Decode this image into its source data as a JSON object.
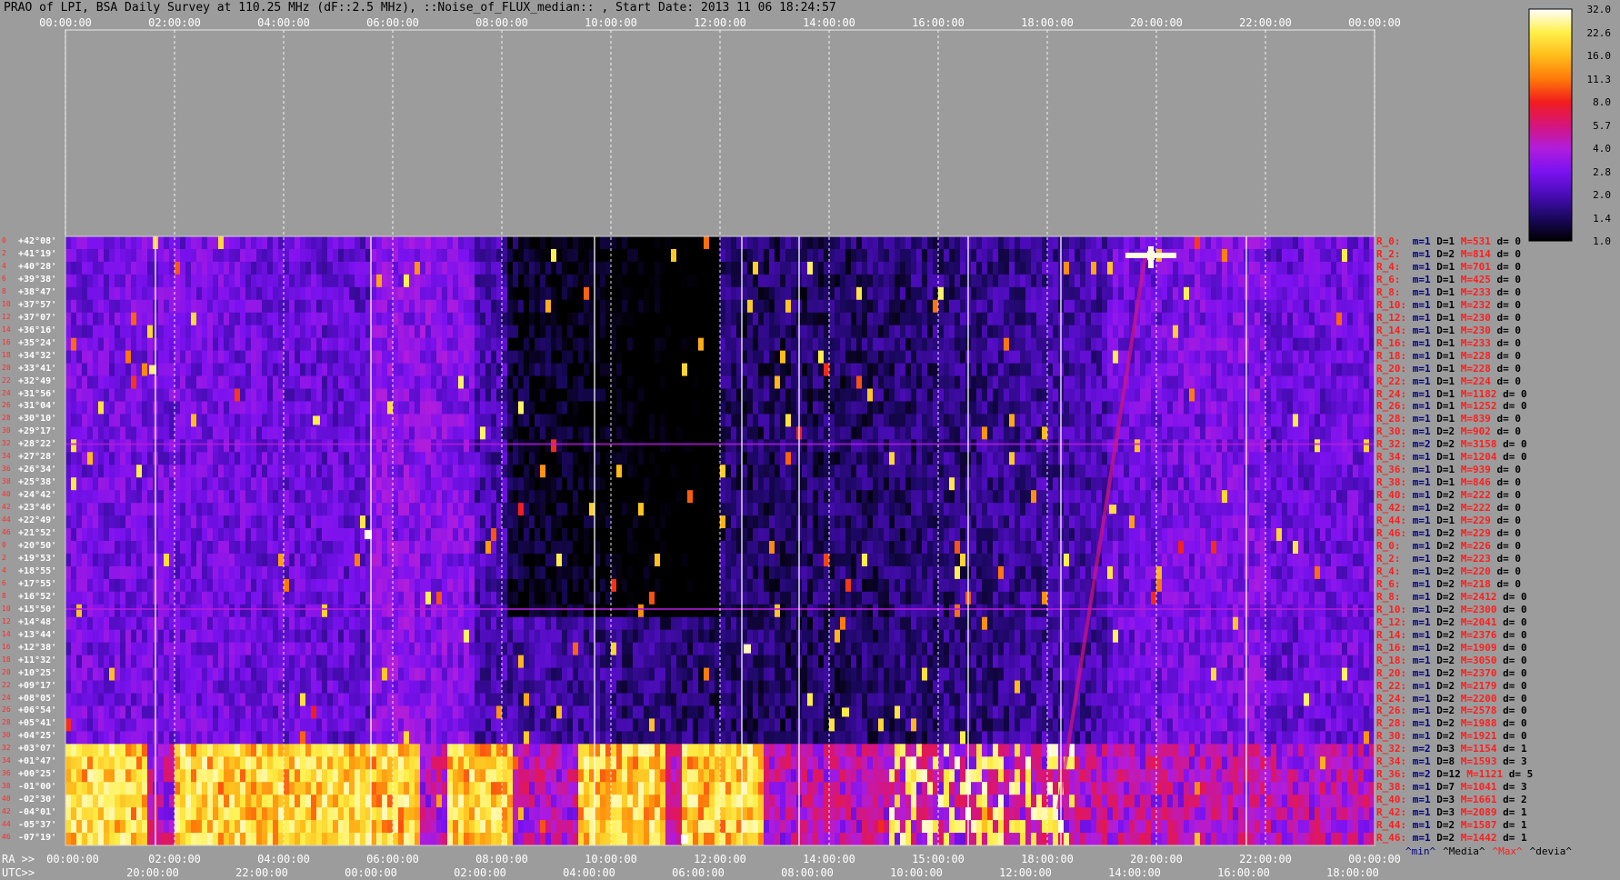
{
  "title": "PRAO of LPI, BSA Daily Survey at 110.25 MHz (dF::2.5 MHz), ::Noise_of_FLUX_median:: , Start Date: 2013 11 06 18:24:57",
  "axes": {
    "top_ticks": [
      "00:00:00",
      "02:00:00",
      "04:00:00",
      "06:00:00",
      "08:00:00",
      "10:00:00",
      "12:00:00",
      "14:00:00",
      "16:00:00",
      "18:00:00",
      "20:00:00",
      "22:00:00",
      "00:00:00"
    ],
    "ra_label": "RA >>",
    "ra_ticks": [
      "00:00:00",
      "02:00:00",
      "04:00:00",
      "06:00:00",
      "08:00:00",
      "10:00:00",
      "12:00:00",
      "14:00:00",
      "15:00:00",
      "18:00:00",
      "20:00:00",
      "22:00:00",
      "00:00:00"
    ],
    "utc_label": "UTC>>",
    "utc_ticks": [
      "20:00:00",
      "22:00:00",
      "00:00:00",
      "02:00:00",
      "04:00:00",
      "06:00:00",
      "08:00:00",
      "10:00:00",
      "12:00:00",
      "14:00:00",
      "16:00:00",
      "18:00:00"
    ]
  },
  "colorbar": {
    "labels": [
      "32.0",
      "22.6",
      "16.0",
      "11.3",
      "8.0",
      "5.7",
      "4.0",
      "2.8",
      "2.0",
      "1.4",
      "1.0"
    ],
    "colors": [
      "#ffffff",
      "#fff04a",
      "#ffbd1a",
      "#ff7a0a",
      "#f21d1d",
      "#d6157a",
      "#b11ddc",
      "#7b12f0",
      "#4a0cb8",
      "#1a0860",
      "#000000"
    ]
  },
  "legend_keys": [
    {
      "text": "^min^",
      "color": "#000080"
    },
    {
      "text": "^Media^",
      "color": "#000000"
    },
    {
      "text": "^Max^",
      "color": "#ff1e1e"
    },
    {
      "text": "^devia^",
      "color": "#000000"
    }
  ],
  "chart_data": {
    "type": "heatmap",
    "title": "PRAO of LPI, BSA Daily Survey at 110.25 MHz (dF::2.5 MHz), ::Noise_of_FLUX_median:: , Start Date: 2013 11 06 18:24:57",
    "x_unit": "RA (h)",
    "x_range": [
      0,
      24
    ],
    "y_unit": "declination (beam index)",
    "value_scale": "log",
    "value_range": [
      1.0,
      32.0
    ],
    "declinations": [
      {
        "idx": "0",
        "dec": "+42°08'",
        "stat": "R_0: ",
        "min": "m=1",
        "d": "D=1",
        "max": "M=531",
        "dev": "d= 0"
      },
      {
        "idx": "2",
        "dec": "+41°19'",
        "stat": "R_2: ",
        "min": "m=1",
        "d": "D=2",
        "max": "M=814",
        "dev": "d= 0"
      },
      {
        "idx": "4",
        "dec": "+40°28'",
        "stat": "R_4: ",
        "min": "m=1",
        "d": "D=1",
        "max": "M=701",
        "dev": "d= 0"
      },
      {
        "idx": "6",
        "dec": "+39°38'",
        "stat": "R_6: ",
        "min": "m=1",
        "d": "D=1",
        "max": "M=425",
        "dev": "d= 0"
      },
      {
        "idx": "8",
        "dec": "+38°47'",
        "stat": "R_8: ",
        "min": "m=1",
        "d": "D=1",
        "max": "M=233",
        "dev": "d= 0"
      },
      {
        "idx": "10",
        "dec": "+37°57'",
        "stat": "R_10:",
        "min": "m=1",
        "d": "D=1",
        "max": "M=232",
        "dev": "d= 0"
      },
      {
        "idx": "12",
        "dec": "+37°07'",
        "stat": "R_12:",
        "min": "m=1",
        "d": "D=1",
        "max": "M=230",
        "dev": "d= 0"
      },
      {
        "idx": "14",
        "dec": "+36°16'",
        "stat": "R_14:",
        "min": "m=1",
        "d": "D=1",
        "max": "M=230",
        "dev": "d= 0"
      },
      {
        "idx": "16",
        "dec": "+35°24'",
        "stat": "R_16:",
        "min": "m=1",
        "d": "D=1",
        "max": "M=233",
        "dev": "d= 0"
      },
      {
        "idx": "18",
        "dec": "+34°32'",
        "stat": "R_18:",
        "min": "m=1",
        "d": "D=1",
        "max": "M=228",
        "dev": "d= 0"
      },
      {
        "idx": "20",
        "dec": "+33°41'",
        "stat": "R_20:",
        "min": "m=1",
        "d": "D=1",
        "max": "M=228",
        "dev": "d= 0"
      },
      {
        "idx": "22",
        "dec": "+32°49'",
        "stat": "R_22:",
        "min": "m=1",
        "d": "D=1",
        "max": "M=224",
        "dev": "d= 0"
      },
      {
        "idx": "24",
        "dec": "+31°56'",
        "stat": "R_24:",
        "min": "m=1",
        "d": "D=1",
        "max": "M=1182",
        "dev": "d= 0"
      },
      {
        "idx": "26",
        "dec": "+31°04'",
        "stat": "R_26:",
        "min": "m=1",
        "d": "D=1",
        "max": "M=1252",
        "dev": "d= 0"
      },
      {
        "idx": "28",
        "dec": "+30°10'",
        "stat": "R_28:",
        "min": "m=1",
        "d": "D=1",
        "max": "M=839",
        "dev": "d= 0"
      },
      {
        "idx": "30",
        "dec": "+29°17'",
        "stat": "R_30:",
        "min": "m=1",
        "d": "D=2",
        "max": "M=902",
        "dev": "d= 0"
      },
      {
        "idx": "32",
        "dec": "+28°22'",
        "stat": "R_32:",
        "min": "m=2",
        "d": "D=2",
        "max": "M=3158",
        "dev": "d= 0"
      },
      {
        "idx": "34",
        "dec": "+27°28'",
        "stat": "R_34:",
        "min": "m=1",
        "d": "D=1",
        "max": "M=1204",
        "dev": "d= 0"
      },
      {
        "idx": "36",
        "dec": "+26°34'",
        "stat": "R_36:",
        "min": "m=1",
        "d": "D=1",
        "max": "M=939",
        "dev": "d= 0"
      },
      {
        "idx": "38",
        "dec": "+25°38'",
        "stat": "R_38:",
        "min": "m=1",
        "d": "D=1",
        "max": "M=846",
        "dev": "d= 0"
      },
      {
        "idx": "40",
        "dec": "+24°42'",
        "stat": "R_40:",
        "min": "m=1",
        "d": "D=2",
        "max": "M=222",
        "dev": "d= 0"
      },
      {
        "idx": "42",
        "dec": "+23°46'",
        "stat": "R_42:",
        "min": "m=1",
        "d": "D=2",
        "max": "M=222",
        "dev": "d= 0"
      },
      {
        "idx": "44",
        "dec": "+22°49'",
        "stat": "R_44:",
        "min": "m=1",
        "d": "D=1",
        "max": "M=229",
        "dev": "d= 0"
      },
      {
        "idx": "46",
        "dec": "+21°52'",
        "stat": "R_46:",
        "min": "m=1",
        "d": "D=2",
        "max": "M=229",
        "dev": "d= 0"
      },
      {
        "idx": "0",
        "dec": "+20°50'",
        "stat": "R_0: ",
        "min": "m=1",
        "d": "D=2",
        "max": "M=226",
        "dev": "d= 0"
      },
      {
        "idx": "2",
        "dec": "+19°53'",
        "stat": "R_2: ",
        "min": "m=1",
        "d": "D=2",
        "max": "M=223",
        "dev": "d= 0"
      },
      {
        "idx": "4",
        "dec": "+18°55'",
        "stat": "R_4: ",
        "min": "m=1",
        "d": "D=2",
        "max": "M=220",
        "dev": "d= 0"
      },
      {
        "idx": "6",
        "dec": "+17°55'",
        "stat": "R_6: ",
        "min": "m=1",
        "d": "D=2",
        "max": "M=218",
        "dev": "d= 0"
      },
      {
        "idx": "8",
        "dec": "+16°52'",
        "stat": "R_8: ",
        "min": "m=1",
        "d": "D=2",
        "max": "M=2412",
        "dev": "d= 0"
      },
      {
        "idx": "10",
        "dec": "+15°50'",
        "stat": "R_10:",
        "min": "m=1",
        "d": "D=2",
        "max": "M=2300",
        "dev": "d= 0"
      },
      {
        "idx": "12",
        "dec": "+14°48'",
        "stat": "R_12:",
        "min": "m=1",
        "d": "D=2",
        "max": "M=2041",
        "dev": "d= 0"
      },
      {
        "idx": "14",
        "dec": "+13°44'",
        "stat": "R_14:",
        "min": "m=1",
        "d": "D=2",
        "max": "M=2376",
        "dev": "d= 0"
      },
      {
        "idx": "16",
        "dec": "+12°38'",
        "stat": "R_16:",
        "min": "m=1",
        "d": "D=2",
        "max": "M=1909",
        "dev": "d= 0"
      },
      {
        "idx": "18",
        "dec": "+11°32'",
        "stat": "R_18:",
        "min": "m=1",
        "d": "D=2",
        "max": "M=3050",
        "dev": "d= 0"
      },
      {
        "idx": "20",
        "dec": "+10°25'",
        "stat": "R_20:",
        "min": "m=1",
        "d": "D=2",
        "max": "M=2370",
        "dev": "d= 0"
      },
      {
        "idx": "22",
        "dec": "+09°17'",
        "stat": "R_22:",
        "min": "m=1",
        "d": "D=2",
        "max": "M=2179",
        "dev": "d= 0"
      },
      {
        "idx": "24",
        "dec": "+08°05'",
        "stat": "R_24:",
        "min": "m=1",
        "d": "D=2",
        "max": "M=2200",
        "dev": "d= 0"
      },
      {
        "idx": "26",
        "dec": "+06°54'",
        "stat": "R_26:",
        "min": "m=1",
        "d": "D=2",
        "max": "M=2578",
        "dev": "d= 0"
      },
      {
        "idx": "28",
        "dec": "+05°41'",
        "stat": "R_28:",
        "min": "m=1",
        "d": "D=2",
        "max": "M=1988",
        "dev": "d= 0"
      },
      {
        "idx": "30",
        "dec": "+04°25'",
        "stat": "R_30:",
        "min": "m=1",
        "d": "D=2",
        "max": "M=1921",
        "dev": "d= 0"
      },
      {
        "idx": "32",
        "dec": "+03°07'",
        "stat": "R_32:",
        "min": "m=2",
        "d": "D=3",
        "max": "M=1154",
        "dev": "d= 1"
      },
      {
        "idx": "34",
        "dec": "+01°47'",
        "stat": "R_34:",
        "min": "m=1",
        "d": "D=8",
        "max": "M=1593",
        "dev": "d= 3"
      },
      {
        "idx": "36",
        "dec": "+00°25'",
        "stat": "R_36:",
        "min": "m=2",
        "d": "D=12",
        "max": "M=1121",
        "dev": "d= 5"
      },
      {
        "idx": "38",
        "dec": "-01°00'",
        "stat": "R_38:",
        "min": "m=1",
        "d": "D=7",
        "max": "M=1041",
        "dev": "d= 3"
      },
      {
        "idx": "40",
        "dec": "-02°30'",
        "stat": "R_40:",
        "min": "m=1",
        "d": "D=3",
        "max": "M=1661",
        "dev": "d= 2"
      },
      {
        "idx": "42",
        "dec": "-04°01'",
        "stat": "R_42:",
        "min": "m=1",
        "d": "D=3",
        "max": "M=2089",
        "dev": "d= 1"
      },
      {
        "idx": "44",
        "dec": "-05°37'",
        "stat": "R_44:",
        "min": "m=1",
        "d": "D=2",
        "max": "M=1587",
        "dev": "d= 1"
      },
      {
        "idx": "46",
        "dec": "-07°19'",
        "stat": "R_46:",
        "min": "m=1",
        "d": "D=2",
        "max": "M=1442",
        "dev": "d= 1"
      }
    ],
    "bright_sources": [
      {
        "ra_h": 19.9,
        "row": 1,
        "level": 32
      },
      {
        "ra_h": 5.55,
        "row": 23,
        "level": 30
      },
      {
        "ra_h": 12.5,
        "row": 32,
        "level": 28
      },
      {
        "ra_h": 11.35,
        "row": 47,
        "level": 32
      },
      {
        "ra_h": 1.6,
        "row": 10,
        "level": 24
      },
      {
        "ra_h": 4.6,
        "row": 14,
        "level": 22
      },
      {
        "ra_h": 19.2,
        "row": 21,
        "level": 20
      },
      {
        "ra_h": 14.3,
        "row": 37,
        "level": 22
      }
    ],
    "bright_band_rows": [
      40,
      47
    ]
  }
}
